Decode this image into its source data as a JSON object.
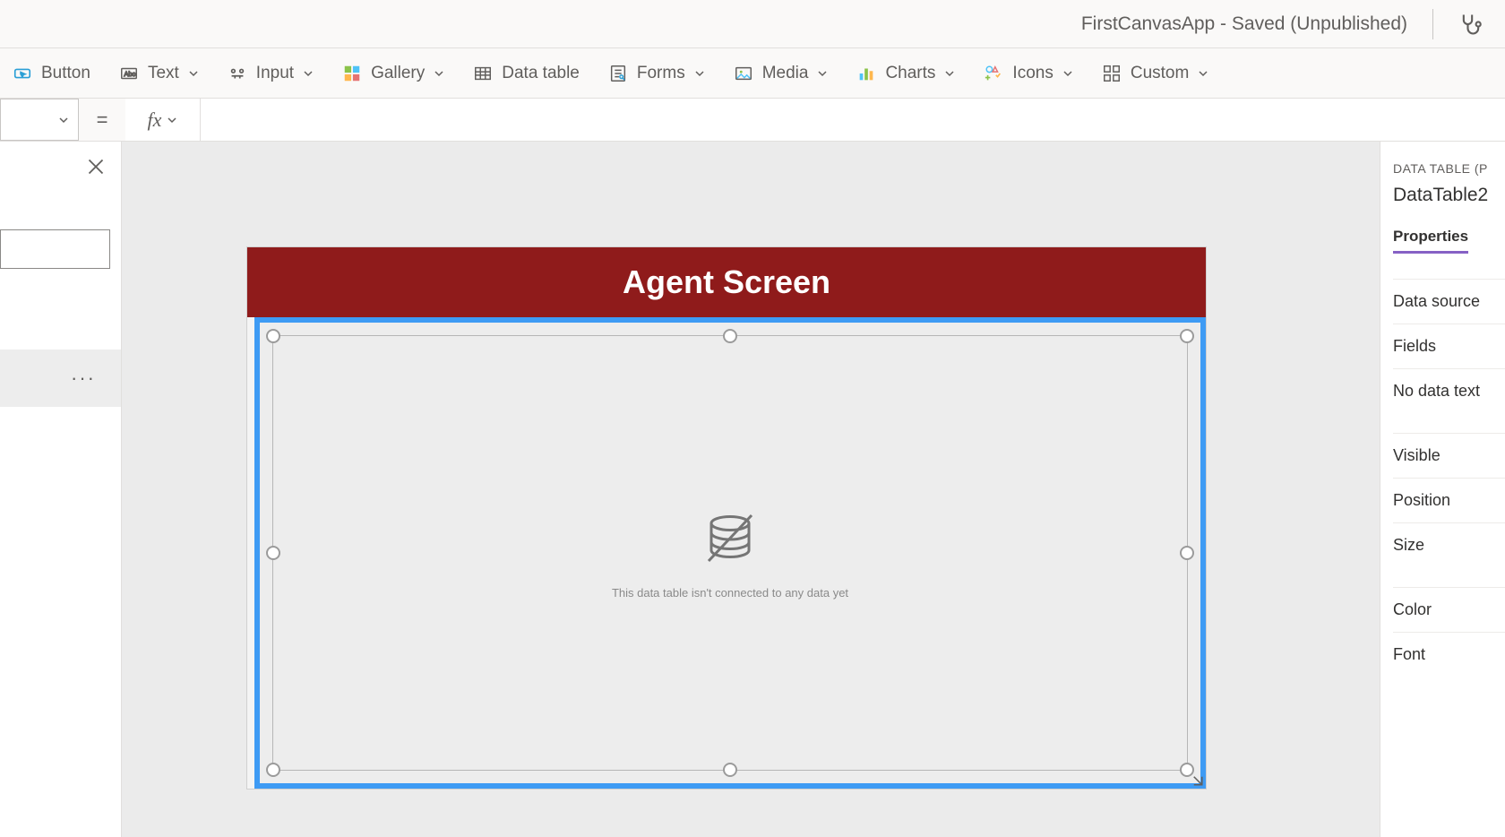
{
  "title": "FirstCanvasApp - Saved (Unpublished)",
  "ribbon": {
    "button": "Button",
    "text": "Text",
    "input": "Input",
    "gallery": "Gallery",
    "datatable": "Data table",
    "forms": "Forms",
    "media": "Media",
    "charts": "Charts",
    "icons": "Icons",
    "custom": "Custom"
  },
  "formula": {
    "equals": "=",
    "fx": "fx",
    "value": ""
  },
  "left": {
    "ellipsis": "···"
  },
  "canvas": {
    "screen_title": "Agent Screen",
    "no_data_msg": "This data table isn't connected to any data yet"
  },
  "right": {
    "type_label": "DATA TABLE (P",
    "control_name": "DataTable2",
    "tab_properties": "Properties",
    "props": {
      "data_source": "Data source",
      "fields": "Fields",
      "no_data_text": "No data text",
      "visible": "Visible",
      "position": "Position",
      "size": "Size",
      "color": "Color",
      "font": "Font"
    }
  }
}
